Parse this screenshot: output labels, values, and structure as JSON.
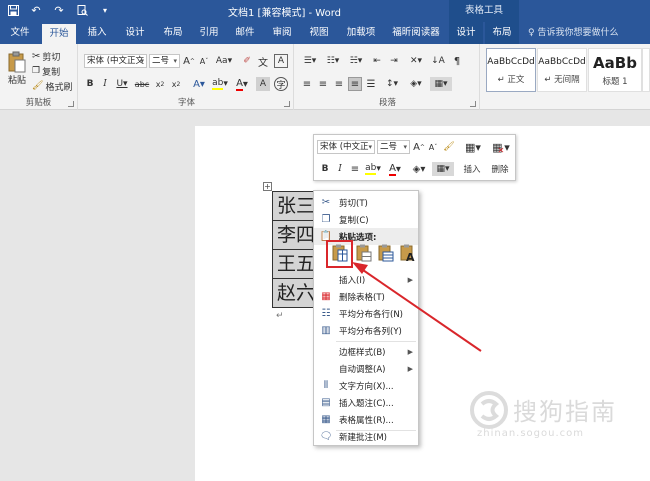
{
  "window": {
    "title": "文档1 [兼容模式] - Word",
    "context_tools_label": "表格工具"
  },
  "tabs": [
    {
      "label": "文件"
    },
    {
      "label": "开始"
    },
    {
      "label": "插入"
    },
    {
      "label": "设计"
    },
    {
      "label": "布局"
    },
    {
      "label": "引用"
    },
    {
      "label": "邮件"
    },
    {
      "label": "审阅"
    },
    {
      "label": "视图"
    },
    {
      "label": "加载项"
    },
    {
      "label": "福昕阅读器"
    },
    {
      "label": "设计"
    },
    {
      "label": "布局"
    }
  ],
  "tell_me": "告诉我你想要做什么",
  "ribbon": {
    "clipboard": {
      "paste": "粘贴",
      "cut": "剪切",
      "copy": "复制",
      "format_painter": "格式刷",
      "group_label": "剪贴板"
    },
    "font": {
      "font_name": "宋体 (中文正文",
      "font_size": "二号",
      "group_label": "字体"
    },
    "paragraph": {
      "group_label": "段落"
    },
    "styles": [
      {
        "sample": "AaBbCcDd",
        "name": "↵ 正文"
      },
      {
        "sample": "AaBbCcDd",
        "name": "↵ 无间隔"
      },
      {
        "sample": "AaBb",
        "name": "标题 1"
      }
    ]
  },
  "table": {
    "cells": [
      "张三",
      "李四",
      "王五",
      "赵六"
    ]
  },
  "minibar": {
    "font_name": "宋体 (中文正",
    "font_size": "二号",
    "insert": "插入",
    "delete": "删除"
  },
  "context_menu": {
    "cut": "剪切(T)",
    "copy": "复制(C)",
    "paste_options": "粘贴选项:",
    "insert": "插入(I)",
    "delete_table": "删除表格(T)",
    "distribute_rows": "平均分布各行(N)",
    "distribute_cols": "平均分布各列(Y)",
    "border_styles": "边框样式(B)",
    "autofit": "自动调整(A)",
    "text_direction": "文字方向(X)...",
    "insert_caption": "插入题注(C)...",
    "table_properties": "表格属性(R)...",
    "new_comment": "新建批注(M)"
  },
  "watermark": {
    "brand": "搜狗指南",
    "url": "zhinan.sogou.com"
  },
  "colors": {
    "word_blue": "#2b579a",
    "context_tab": "#1f4e8c",
    "highlight_red": "#d9262b"
  }
}
